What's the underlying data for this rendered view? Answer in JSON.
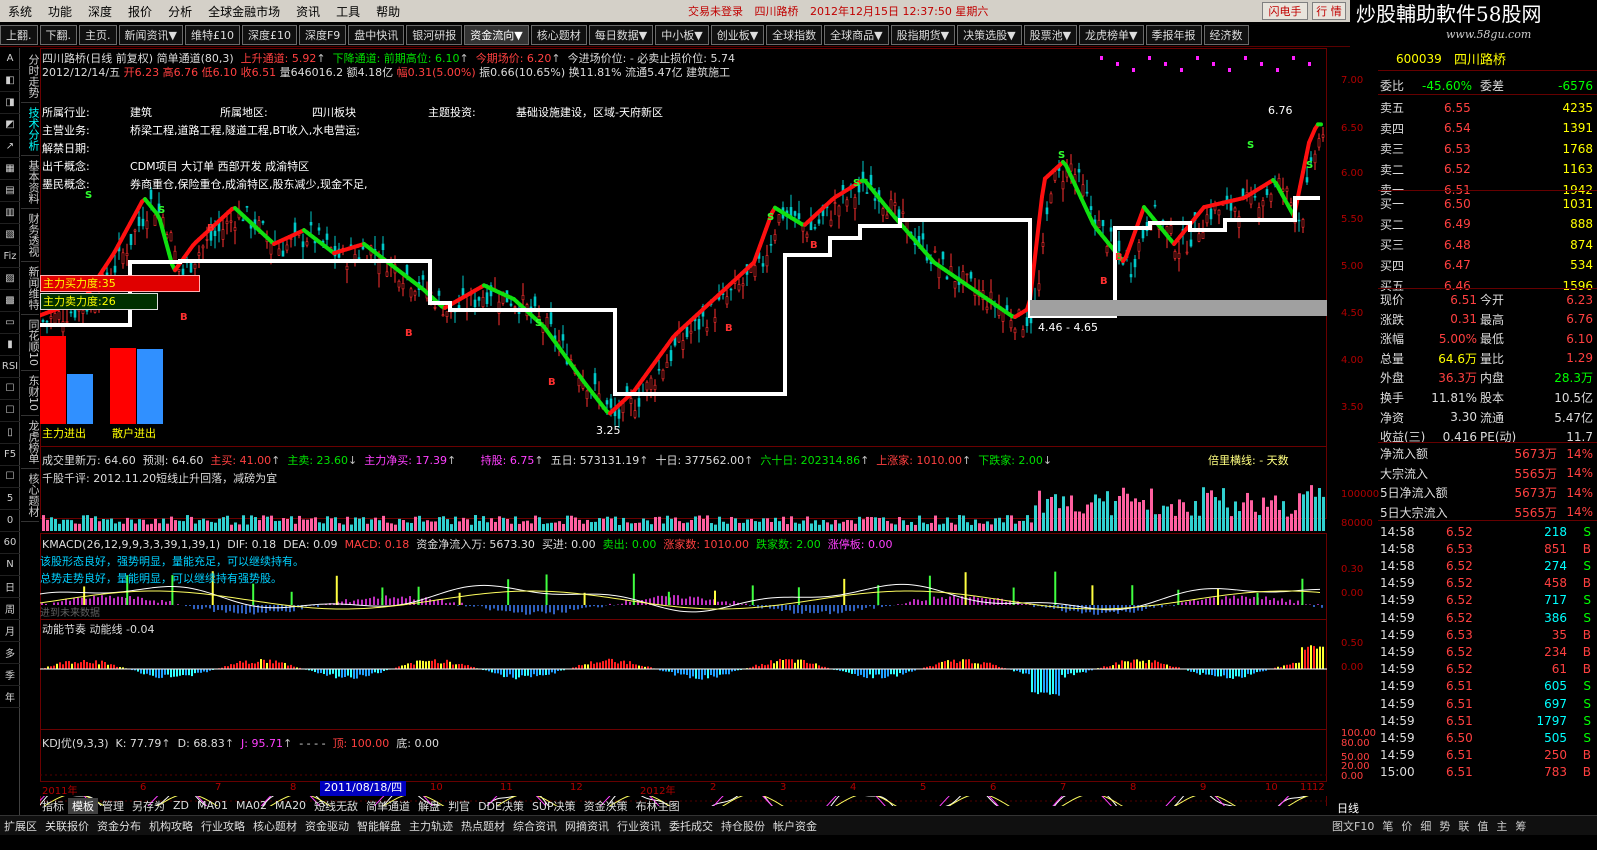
{
  "menu": [
    "系统",
    "功能",
    "深度",
    "报价",
    "分析",
    "全球金融市场",
    "资讯",
    "工具",
    "帮助"
  ],
  "status": {
    "login": "交易未登录",
    "stock": "四川路桥",
    "datetime": "2012年12月15日 12:37:50 星期六"
  },
  "controls": {
    "flash": "闪电手",
    "quote": "行 情"
  },
  "watermark": {
    "text": "炒股輔助軟件58股网",
    "url": "www.58gu.com"
  },
  "toolbar": [
    "上翻.",
    "下翻.",
    "主页.",
    "新闻资讯▼",
    "维特£10",
    "深度£10",
    "深度F9",
    "盘中快讯",
    "银河研报",
    "资金流向▼",
    "核心题材",
    "每日数据▼",
    "中小板▼",
    "创业板▼",
    "全球指数",
    "全球商品▼",
    "股指期货▼",
    "决策选股▼",
    "股票池▼",
    "龙虎榜单▼",
    "季报年报",
    "经济数"
  ],
  "left_nav": [
    "A",
    "◧",
    "◨",
    "◩",
    "↗",
    "▦",
    "▤",
    "▥",
    "▧",
    "Fiz",
    "▨",
    "▩",
    "▭",
    "▮",
    "RSI",
    "☐",
    "☐",
    "▯",
    "F5",
    "☐",
    "5",
    "0",
    "60",
    "N",
    "日",
    "周",
    "月",
    "多",
    "季",
    "年"
  ],
  "vertical_tabs": [
    "分时走势",
    "技术分析",
    "基本资料",
    "财务透视",
    "新闻维特",
    "同花顺10",
    "东财10",
    "龙虎榜单",
    "核心题材"
  ],
  "chart_header": {
    "name": "四川路桥(日线 前复权) 简单通道(80,3)",
    "up_channel": "上升通道: 5.92",
    "down_channel": "下降通道: 前期高位: 6.10",
    "today_price": "今期场价: 6.20",
    "entry": "今进场价位: - 必卖止损价位: 5.74",
    "date": "2012/12/14/五",
    "open": "开6.23",
    "high": "高6.76",
    "low": "低6.10",
    "close": "收6.51",
    "vol": "量646016.2",
    "amount": "额4.18亿",
    "change": "幅0.31(5.00%)",
    "amp": "振0.66(10.65%)",
    "turnover": "换11.81%",
    "float": "流通5.47亿",
    "sector": "建筑施工"
  },
  "info": [
    {
      "k": "所属行业:",
      "v": "建筑",
      "k2": "所属地区:",
      "v2": "四川板块",
      "k3": "主题投资:",
      "v3": "基础设施建设，区域-天府新区"
    },
    {
      "k": "主营业务:",
      "v": "桥梁工程,道路工程,隧道工程,BT收入,水电营运;"
    },
    {
      "k": "解禁日期:",
      "v": ""
    },
    {
      "k": "出千概念:",
      "v": "CDM项目 大订单 西部开发 成渝特区"
    },
    {
      "k": "墨民概念:",
      "v": "券商重仓,保险重仓,成渝特区,股东减少,现金不足,"
    }
  ],
  "force": {
    "buy": "主力买力度:35",
    "sell": "主力卖力度:26",
    "in": "主力进出",
    "retail": "散户进出"
  },
  "price_annotations": {
    "high": "6.76",
    "low": "3.25",
    "range": "4.46 - 4.65"
  },
  "y_axis_price": [
    "7.00",
    "6.50",
    "6.00",
    "5.50",
    "5.00",
    "4.50",
    "4.00",
    "3.50"
  ],
  "vol_header": {
    "a": "成交里新万: 64.60",
    "b": "预测: 64.60",
    "c": "主买: 41.00",
    "d": "主卖: 23.60",
    "e": "主力净买: 17.39",
    "f": "持股: 6.75",
    "g": "五日: 573131.19",
    "h": "十日: 377562.00",
    "i": "六十日: 202314.86",
    "j": "上涨家: 1010.00",
    "k": "下跌家: 2.00",
    "l": "倍里横线: - 天数"
  },
  "vol_comment": "千股千评: 2012.11.20短线止升回落，减磅为宜",
  "y_axis_vol": [
    "100000",
    "80000"
  ],
  "macd_header": {
    "a": "KMACD(26,12,9,9,3,3,39,1,39,1)",
    "b": "DIF: 0.18",
    "c": "DEA: 0.09",
    "d": "MACD: 0.18",
    "e": "资金净流入万: 5673.30",
    "f": "买进: 0.00",
    "g": "卖出: 0.00",
    "h": "涨家数: 1010.00",
    "i": "跌家数: 2.00",
    "j": "涨停板: 0.00"
  },
  "macd_comments": [
    "该股形态良好，强势明显，量能充足，可以继续持有。",
    "总势走势良好，量能明显，可以继续持有强势股。",
    "进到未来数据"
  ],
  "y_axis_macd": [
    "0.30",
    "0.00"
  ],
  "momentum_header": "动能节奏 动能线 -0.04",
  "y_axis_mom": [
    "0.50",
    "0.00"
  ],
  "kdj_header": {
    "a": "KDJ优(9,3,3)",
    "b": "K: 77.79",
    "c": "D: 68.83",
    "d": "J: 95.71",
    "e": "- - - -",
    "f": "顶: 100.00",
    "g": "底: 0.00"
  },
  "y_axis_kdj": [
    "100.00",
    "80.00",
    "50.00",
    "20.00",
    "0.00"
  ],
  "x_axis": [
    "2011年",
    "6",
    "7",
    "8",
    "9",
    "10",
    "11",
    "12",
    "2012年",
    "2",
    "3",
    "4",
    "5",
    "6",
    "7",
    "8",
    "9",
    "10",
    "11",
    "12"
  ],
  "x_cursor": "2011/08/18/四",
  "bottom_tabs": [
    "指标",
    "模板",
    "管理",
    "另存为",
    "ZD",
    "MA01",
    "MA02",
    "MA20",
    "短线无敌",
    "简单通道",
    "解盘",
    "判官",
    "DDE决策",
    "SUP决策",
    "资金决策",
    "布林主图"
  ],
  "bottom_bar": [
    "扩展区",
    "关联报价",
    "资金分布",
    "机构攻略",
    "行业攻略",
    "核心题材",
    "资金驱动",
    "智能解盘",
    "主力轨迹",
    "热点题材",
    "综合资讯",
    "网摘资讯",
    "行业资讯",
    "委托成交",
    "持仓股份",
    "帐户资金"
  ],
  "bottom_tail": [
    "图文F10",
    "笔",
    "价",
    "细",
    "势",
    "联",
    "值",
    "主",
    "筹"
  ],
  "period": "日线",
  "quote": {
    "code": "600039",
    "name": "四川路桥",
    "webi_label": "委比",
    "webi": "-45.60%",
    "wecha_label": "委差",
    "wecha": "-6576",
    "asks": [
      {
        "l": "卖五",
        "p": "6.55",
        "v": "4235"
      },
      {
        "l": "卖四",
        "p": "6.54",
        "v": "1391"
      },
      {
        "l": "卖三",
        "p": "6.53",
        "v": "1768"
      },
      {
        "l": "卖二",
        "p": "6.52",
        "v": "1163"
      },
      {
        "l": "卖一",
        "p": "6.51",
        "v": "1942"
      }
    ],
    "bids": [
      {
        "l": "买一",
        "p": "6.50",
        "v": "1031"
      },
      {
        "l": "买二",
        "p": "6.49",
        "v": "888"
      },
      {
        "l": "买三",
        "p": "6.48",
        "v": "874"
      },
      {
        "l": "买四",
        "p": "6.47",
        "v": "534"
      },
      {
        "l": "买五",
        "p": "6.46",
        "v": "1596"
      }
    ],
    "stats": [
      {
        "l": "现价",
        "v": "6.51",
        "l2": "今开",
        "v2": "6.23"
      },
      {
        "l": "涨跌",
        "v": "0.31",
        "l2": "最高",
        "v2": "6.76"
      },
      {
        "l": "涨幅",
        "v": "5.00%",
        "l2": "最低",
        "v2": "6.10"
      },
      {
        "l": "总量",
        "v": "64.6万",
        "l2": "量比",
        "v2": "1.29"
      },
      {
        "l": "外盘",
        "v": "36.3万",
        "l2": "内盘",
        "v2": "28.3万"
      },
      {
        "l": "换手",
        "v": "11.81%",
        "l2": "股本",
        "v2": "10.5亿"
      },
      {
        "l": "净资",
        "v": "3.30",
        "l2": "流通",
        "v2": "5.47亿"
      },
      {
        "l": "收益(三)",
        "v": "0.416",
        "l2": "PE(动)",
        "v2": "11.7"
      }
    ],
    "flows": [
      {
        "l": "净流入额",
        "v": "5673万",
        "p": "14%"
      },
      {
        "l": "大宗流入",
        "v": "5565万",
        "p": "14%"
      },
      {
        "l": "5日净流入额",
        "v": "5673万",
        "p": "14%"
      },
      {
        "l": "5日大宗流入",
        "v": "5565万",
        "p": "14%"
      }
    ],
    "ticks": [
      {
        "t": "14:58",
        "p": "6.52",
        "v": "218",
        "s": "S"
      },
      {
        "t": "14:58",
        "p": "6.53",
        "v": "851",
        "s": "B"
      },
      {
        "t": "14:58",
        "p": "6.52",
        "v": "274",
        "s": "S"
      },
      {
        "t": "14:59",
        "p": "6.52",
        "v": "458",
        "s": "B"
      },
      {
        "t": "14:59",
        "p": "6.52",
        "v": "717",
        "s": "S"
      },
      {
        "t": "14:59",
        "p": "6.52",
        "v": "386",
        "s": "S"
      },
      {
        "t": "14:59",
        "p": "6.53",
        "v": "35",
        "s": "B"
      },
      {
        "t": "14:59",
        "p": "6.52",
        "v": "234",
        "s": "B"
      },
      {
        "t": "14:59",
        "p": "6.52",
        "v": "61",
        "s": "B"
      },
      {
        "t": "14:59",
        "p": "6.51",
        "v": "605",
        "s": "S"
      },
      {
        "t": "14:59",
        "p": "6.51",
        "v": "697",
        "s": "S"
      },
      {
        "t": "14:59",
        "p": "6.51",
        "v": "1797",
        "s": "S"
      },
      {
        "t": "14:59",
        "p": "6.50",
        "v": "505",
        "s": "S"
      },
      {
        "t": "14:59",
        "p": "6.51",
        "v": "250",
        "s": "B"
      },
      {
        "t": "15:00",
        "p": "6.51",
        "v": "783",
        "s": "B"
      }
    ]
  }
}
